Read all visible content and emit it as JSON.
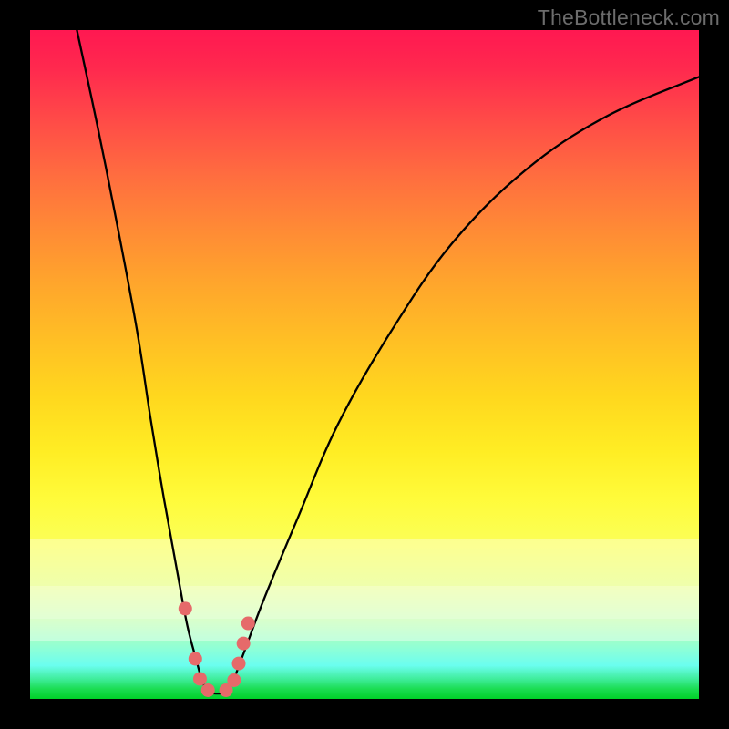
{
  "watermark": "TheBottleneck.com",
  "chart_data": {
    "type": "line",
    "title": "",
    "xlabel": "",
    "ylabel": "",
    "xlim": [
      0,
      100
    ],
    "ylim": [
      0,
      100
    ],
    "grid": false,
    "legend": false,
    "series": [
      {
        "name": "left-curve",
        "x": [
          7,
          10,
          13,
          16,
          18,
          20,
          22,
          23.5,
          24.8,
          25.6
        ],
        "y": [
          100,
          86,
          71,
          55,
          42,
          30,
          19,
          11,
          6,
          3
        ]
      },
      {
        "name": "right-curve",
        "x": [
          30.5,
          32,
          35,
          40,
          46,
          54,
          63,
          74,
          86,
          100
        ],
        "y": [
          3,
          7,
          15,
          27,
          41,
          55,
          68,
          79,
          87,
          93
        ]
      },
      {
        "name": "valley-floor",
        "x": [
          25.6,
          26.5,
          28,
          29.5,
          30.5
        ],
        "y": [
          3,
          1.2,
          0.8,
          1.2,
          3
        ]
      }
    ],
    "markers": [
      {
        "name": "dot-left-upper",
        "x": 23.2,
        "y": 13.5
      },
      {
        "name": "dot-left-mid",
        "x": 24.7,
        "y": 6.0
      },
      {
        "name": "dot-left-low",
        "x": 25.4,
        "y": 3.0
      },
      {
        "name": "dot-floor-left",
        "x": 26.6,
        "y": 1.3
      },
      {
        "name": "dot-floor-right",
        "x": 29.3,
        "y": 1.3
      },
      {
        "name": "dot-right-low",
        "x": 30.5,
        "y": 2.8
      },
      {
        "name": "dot-right-mid1",
        "x": 31.2,
        "y": 5.3
      },
      {
        "name": "dot-right-mid2",
        "x": 31.9,
        "y": 8.3
      },
      {
        "name": "dot-right-upper",
        "x": 32.6,
        "y": 11.3
      }
    ],
    "marker_color": "#e66a6a",
    "curve_color": "#000000",
    "background_gradient": {
      "top": "#ff1851",
      "mid": "#ffed24",
      "bottom": "#00d028"
    }
  }
}
